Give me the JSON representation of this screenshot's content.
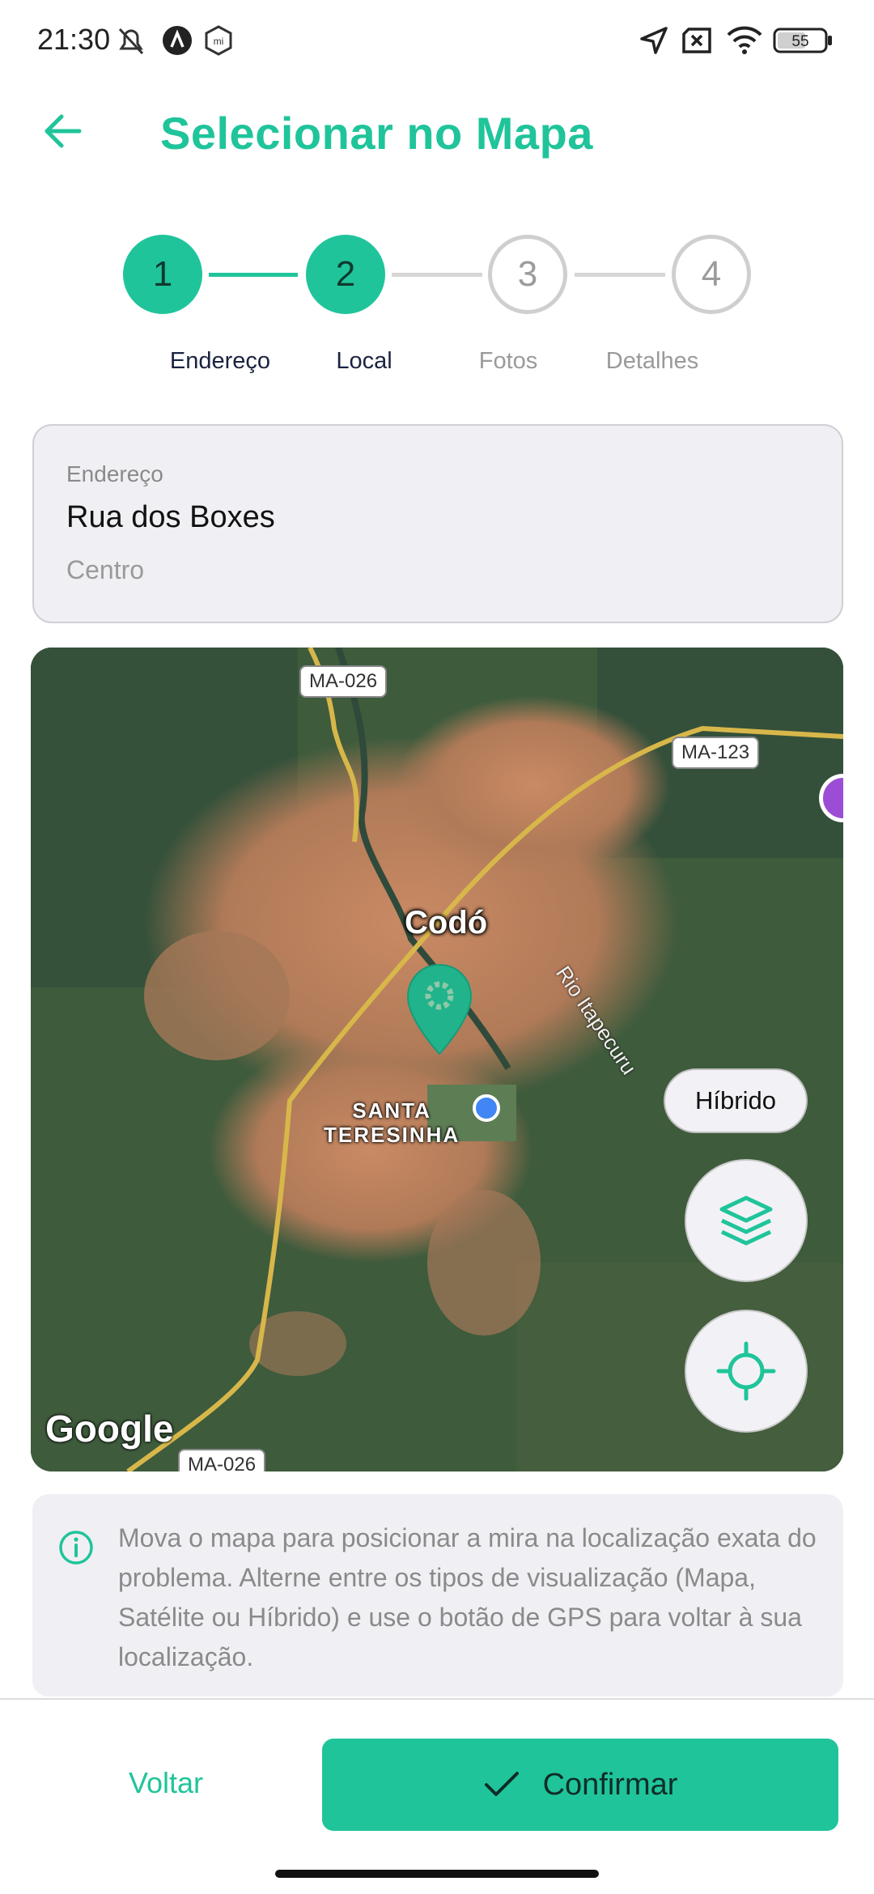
{
  "status_bar": {
    "time": "21:30",
    "battery": "55",
    "icons": [
      "mute-icon",
      "a-icon",
      "mi-icon",
      "location-arrow-icon",
      "sim-off-icon",
      "wifi-icon",
      "battery-icon"
    ]
  },
  "header": {
    "title": "Selecionar no Mapa",
    "back_icon": "arrow-left-icon"
  },
  "stepper": {
    "steps": [
      {
        "number": "1",
        "label": "Endereço",
        "state": "active"
      },
      {
        "number": "2",
        "label": "Local",
        "state": "active"
      },
      {
        "number": "3",
        "label": "Fotos",
        "state": "inactive"
      },
      {
        "number": "4",
        "label": "Detalhes",
        "state": "inactive"
      }
    ]
  },
  "address": {
    "label": "Endereço",
    "street": "Rua dos Boxes",
    "district": "Centro"
  },
  "map": {
    "city": "Codó",
    "neighborhood_line1": "SANTA",
    "neighborhood_line2": "TERESINHA",
    "river": "Rio Itapecuru",
    "roads": [
      "MA-026",
      "MA-123",
      "MA-026"
    ],
    "map_type": "Híbrido",
    "attribution": "Google",
    "layers_icon": "layers-icon",
    "gps_icon": "crosshair-icon",
    "pin_icon": "map-pin-icon"
  },
  "info": {
    "icon": "info-icon",
    "text": "Mova o mapa para posicionar a mira na localização exata do problema. Alterne entre os tipos de visualização (Mapa, Satélite ou Híbrido) e use o botão de GPS para voltar à sua localização."
  },
  "actions": {
    "back_label": "Voltar",
    "confirm_label": "Confirmar"
  },
  "colors": {
    "accent": "#20c49a",
    "surface": "#f0f0f4"
  }
}
